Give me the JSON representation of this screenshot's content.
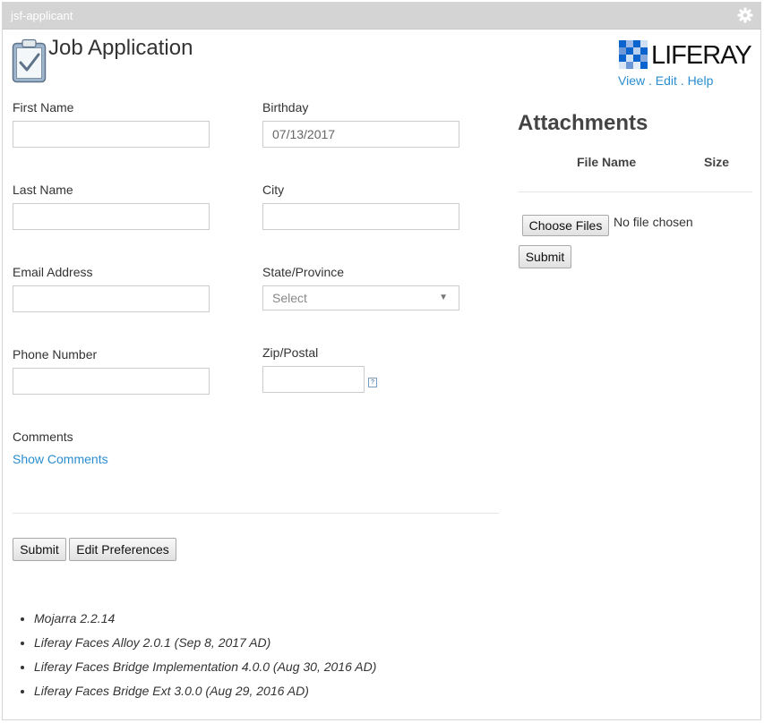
{
  "portlet": {
    "title": "jsf-applicant"
  },
  "header": {
    "title": "Job Application",
    "logo_text": "LIFERAY",
    "links": {
      "view": "View",
      "edit": "Edit",
      "help": "Help",
      "separator": "."
    }
  },
  "form": {
    "first_name": {
      "label": "First Name",
      "value": ""
    },
    "last_name": {
      "label": "Last Name",
      "value": ""
    },
    "email": {
      "label": "Email Address",
      "value": ""
    },
    "phone": {
      "label": "Phone Number",
      "value": ""
    },
    "birthday": {
      "label": "Birthday",
      "value": "07/13/2017"
    },
    "city": {
      "label": "City",
      "value": ""
    },
    "state": {
      "label": "State/Province",
      "selected": "Select"
    },
    "zip": {
      "label": "Zip/Postal",
      "value": "",
      "help_glyph": "?"
    },
    "comments": {
      "label": "Comments",
      "toggle_link": "Show Comments"
    },
    "buttons": {
      "submit": "Submit",
      "edit_preferences": "Edit Preferences"
    }
  },
  "attachments": {
    "heading": "Attachments",
    "columns": [
      "File Name",
      "Size"
    ],
    "choose_files_label": "Choose Files",
    "no_file_text": "No file chosen",
    "submit_label": "Submit"
  },
  "versions": [
    "Mojarra 2.2.14",
    "Liferay Faces Alloy 2.0.1 (Sep 8, 2017 AD)",
    "Liferay Faces Bridge Implementation 4.0.0 (Aug 30, 2016 AD)",
    "Liferay Faces Bridge Ext 3.0.0 (Aug 29, 2016 AD)"
  ],
  "colors": {
    "link": "#2a8dcf",
    "titlebar": "#d4d4d4"
  },
  "icons": {
    "gear": "gear-icon",
    "clipboard": "clipboard-check-icon",
    "logo": "liferay-logo",
    "caret": "caret-down-icon"
  }
}
